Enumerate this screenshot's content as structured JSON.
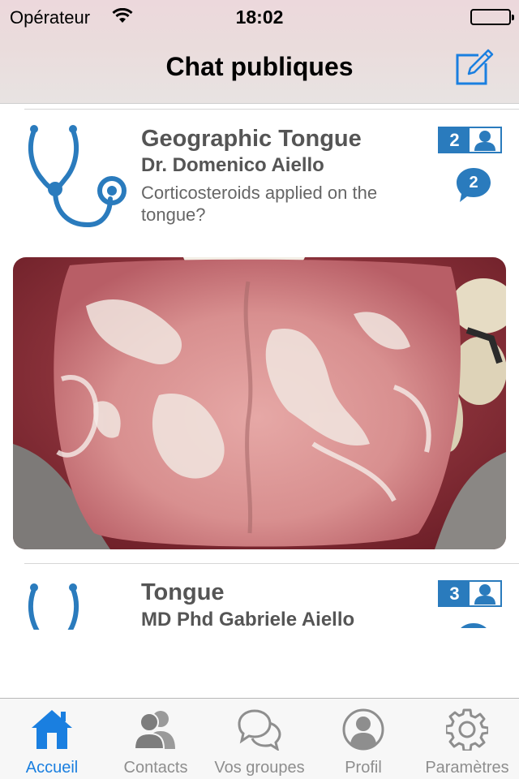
{
  "status_bar": {
    "carrier": "Opérateur",
    "time": "18:02"
  },
  "nav": {
    "title": "Chat publiques",
    "compose_icon": "compose-icon"
  },
  "chats": [
    {
      "title": "Geographic Tongue",
      "author": "Dr. Domenico Aiello",
      "message": "Corticosteroids applied on the tongue?",
      "members": "2",
      "messages": "2",
      "icon": "stethoscope-icon"
    },
    {
      "title": "Tongue",
      "author": "MD Phd Gabriele Aiello",
      "members": "3",
      "icon": "stethoscope-icon"
    }
  ],
  "tabs": [
    {
      "label": "Accueil",
      "icon": "home-icon",
      "active": true
    },
    {
      "label": "Contacts",
      "icon": "contacts-icon"
    },
    {
      "label": "Vos groupes",
      "icon": "groups-icon"
    },
    {
      "label": "Profil",
      "icon": "profile-icon"
    },
    {
      "label": "Paramètres",
      "icon": "settings-icon"
    }
  ],
  "colors": {
    "accent": "#1a7fe0",
    "icon_blue": "#2a7bbd",
    "tab_inactive": "#8e8e8e"
  }
}
